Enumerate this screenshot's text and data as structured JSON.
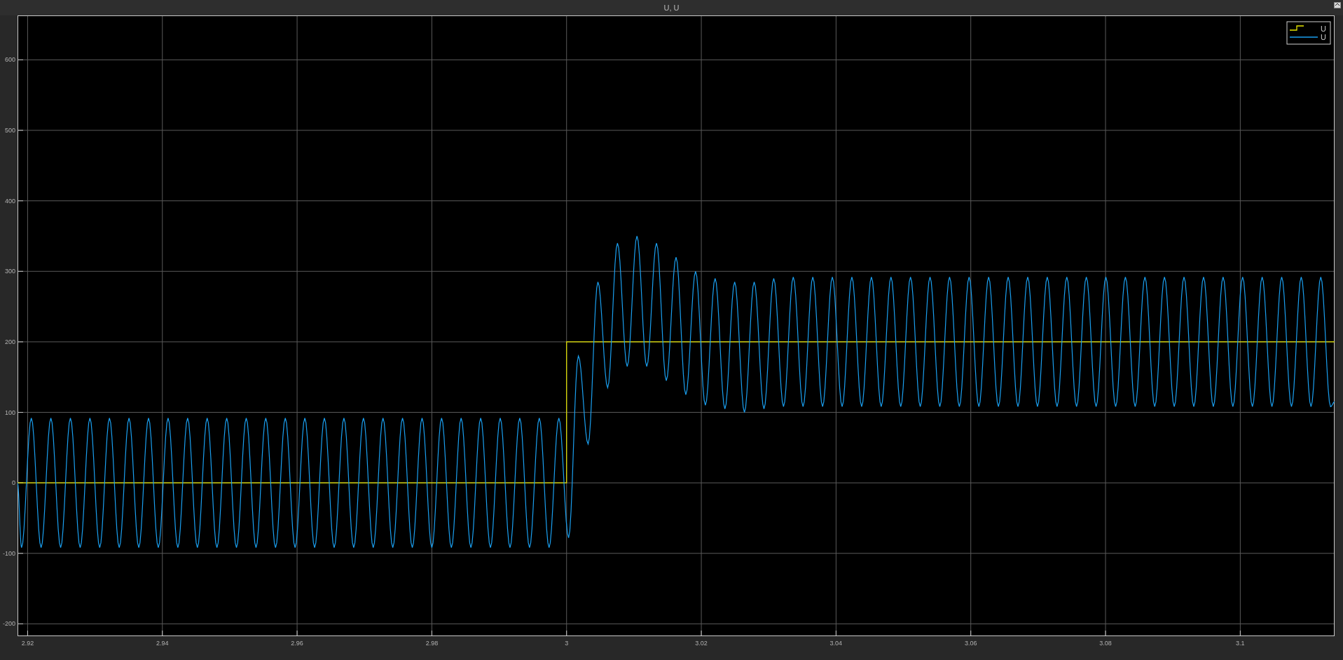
{
  "chart_data": {
    "type": "line",
    "title": "U, U",
    "grid": true,
    "xlim": [
      2.9185,
      3.114
    ],
    "ylim": [
      -217.5,
      663
    ],
    "xticks": [
      2.92,
      2.94,
      2.96,
      2.98,
      3,
      3.02,
      3.04,
      3.06,
      3.08,
      3.1
    ],
    "yticks": [
      -200,
      -100,
      0,
      100,
      200,
      300,
      400,
      500,
      600
    ],
    "series": [
      {
        "name": "U",
        "color": "#e6e600",
        "x": [
          2.9185,
          3,
          3,
          3.114
        ],
        "values": [
          0,
          0,
          200,
          200
        ]
      },
      {
        "name": "U",
        "color": "#1a9fef",
        "x": [
          2.9185,
          2.9191,
          2.92055,
          2.922,
          2.92345,
          2.9249,
          2.92635,
          2.9278,
          2.92925,
          2.9307,
          2.93215,
          2.9336,
          2.93505,
          2.9365,
          2.93795,
          2.9394,
          2.94085,
          2.9423,
          2.94375,
          2.9452,
          2.94665,
          2.9481,
          2.94955,
          2.951,
          2.95245,
          2.9539,
          2.95535,
          2.9568,
          2.95825,
          2.9597,
          2.96115,
          2.9626,
          2.96405,
          2.9655,
          2.96695,
          2.9684,
          2.96985,
          2.9713,
          2.97275,
          2.9742,
          2.97565,
          2.9771,
          2.97855,
          2.98,
          2.98145,
          2.9829,
          2.98435,
          2.9858,
          2.98725,
          2.9887,
          2.99015,
          2.9916,
          2.99305,
          2.9945,
          2.99595,
          2.9974,
          2.99885,
          3.0003,
          3.00175,
          3.0032,
          3.00465,
          3.0061,
          3.00755,
          3.009,
          3.01045,
          3.0119,
          3.01335,
          3.0148,
          3.01625,
          3.0177,
          3.01915,
          3.0206,
          3.02205,
          3.0235,
          3.02495,
          3.0264,
          3.02785,
          3.0293,
          3.03075,
          3.0322,
          3.03365,
          3.0351,
          3.03655,
          3.038,
          3.03945,
          3.0409,
          3.04235,
          3.0438,
          3.04525,
          3.0467,
          3.04815,
          3.0496,
          3.05105,
          3.0525,
          3.05395,
          3.0554,
          3.05685,
          3.0583,
          3.05975,
          3.0612,
          3.06265,
          3.0641,
          3.06555,
          3.067,
          3.06845,
          3.0699,
          3.07135,
          3.0728,
          3.07425,
          3.0757,
          3.07715,
          3.0786,
          3.08005,
          3.0815,
          3.08295,
          3.0844,
          3.08585,
          3.0873,
          3.08875,
          3.0902,
          3.09165,
          3.0931,
          3.09455,
          3.096,
          3.09745,
          3.0989,
          3.10035,
          3.1018,
          3.10325,
          3.1047,
          3.10615,
          3.1076,
          3.10905,
          3.1105,
          3.11195,
          3.1134,
          3.114
        ],
        "values": [
          0,
          -92,
          92,
          -92,
          92,
          -92,
          92,
          -92,
          92,
          -92,
          92,
          -92,
          92,
          -92,
          92,
          -92,
          92,
          -92,
          92,
          -92,
          92,
          -92,
          92,
          -92,
          92,
          -92,
          92,
          -92,
          92,
          -92,
          92,
          -92,
          92,
          -92,
          92,
          -92,
          92,
          -92,
          92,
          -92,
          92,
          -92,
          92,
          -92,
          92,
          -92,
          92,
          -92,
          92,
          -92,
          92,
          -92,
          92,
          -92,
          92,
          -92,
          92,
          -78,
          180,
          55,
          285,
          135,
          340,
          165,
          350,
          165,
          340,
          145,
          320,
          125,
          300,
          110,
          290,
          105,
          285,
          100,
          285,
          105,
          290,
          108,
          292,
          108,
          292,
          108,
          292,
          108,
          292,
          108,
          292,
          108,
          292,
          108,
          292,
          108,
          292,
          108,
          292,
          108,
          292,
          108,
          292,
          108,
          292,
          108,
          292,
          108,
          292,
          108,
          292,
          108,
          292,
          108,
          292,
          108,
          292,
          108,
          292,
          108,
          292,
          108,
          292,
          108,
          292,
          108,
          292,
          108,
          292,
          108,
          292,
          108,
          292,
          108,
          292,
          108,
          292,
          108,
          115
        ]
      }
    ]
  }
}
